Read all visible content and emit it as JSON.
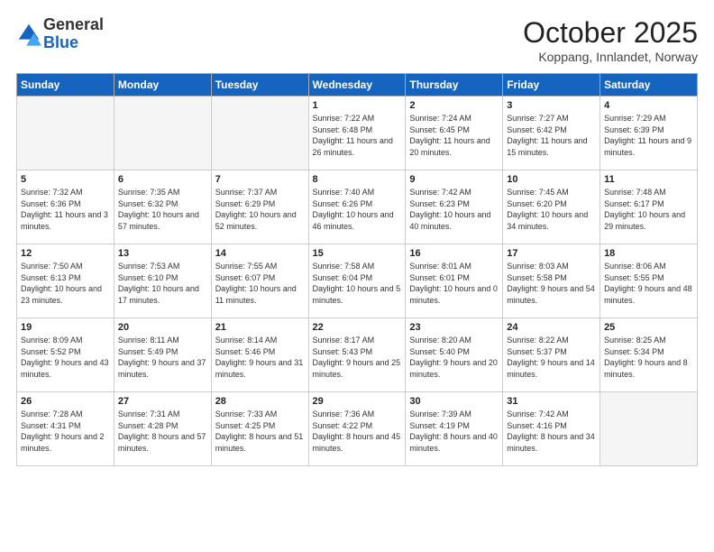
{
  "header": {
    "logo_general": "General",
    "logo_blue": "Blue",
    "month_title": "October 2025",
    "subtitle": "Koppang, Innlandet, Norway"
  },
  "days_of_week": [
    "Sunday",
    "Monday",
    "Tuesday",
    "Wednesday",
    "Thursday",
    "Friday",
    "Saturday"
  ],
  "weeks": [
    [
      {
        "day": "",
        "sunrise": "",
        "sunset": "",
        "daylight": "",
        "empty": true
      },
      {
        "day": "",
        "sunrise": "",
        "sunset": "",
        "daylight": "",
        "empty": true
      },
      {
        "day": "",
        "sunrise": "",
        "sunset": "",
        "daylight": "",
        "empty": true
      },
      {
        "day": "1",
        "sunrise": "Sunrise: 7:22 AM",
        "sunset": "Sunset: 6:48 PM",
        "daylight": "Daylight: 11 hours and 26 minutes.",
        "empty": false
      },
      {
        "day": "2",
        "sunrise": "Sunrise: 7:24 AM",
        "sunset": "Sunset: 6:45 PM",
        "daylight": "Daylight: 11 hours and 20 minutes.",
        "empty": false
      },
      {
        "day": "3",
        "sunrise": "Sunrise: 7:27 AM",
        "sunset": "Sunset: 6:42 PM",
        "daylight": "Daylight: 11 hours and 15 minutes.",
        "empty": false
      },
      {
        "day": "4",
        "sunrise": "Sunrise: 7:29 AM",
        "sunset": "Sunset: 6:39 PM",
        "daylight": "Daylight: 11 hours and 9 minutes.",
        "empty": false
      }
    ],
    [
      {
        "day": "5",
        "sunrise": "Sunrise: 7:32 AM",
        "sunset": "Sunset: 6:36 PM",
        "daylight": "Daylight: 11 hours and 3 minutes.",
        "empty": false
      },
      {
        "day": "6",
        "sunrise": "Sunrise: 7:35 AM",
        "sunset": "Sunset: 6:32 PM",
        "daylight": "Daylight: 10 hours and 57 minutes.",
        "empty": false
      },
      {
        "day": "7",
        "sunrise": "Sunrise: 7:37 AM",
        "sunset": "Sunset: 6:29 PM",
        "daylight": "Daylight: 10 hours and 52 minutes.",
        "empty": false
      },
      {
        "day": "8",
        "sunrise": "Sunrise: 7:40 AM",
        "sunset": "Sunset: 6:26 PM",
        "daylight": "Daylight: 10 hours and 46 minutes.",
        "empty": false
      },
      {
        "day": "9",
        "sunrise": "Sunrise: 7:42 AM",
        "sunset": "Sunset: 6:23 PM",
        "daylight": "Daylight: 10 hours and 40 minutes.",
        "empty": false
      },
      {
        "day": "10",
        "sunrise": "Sunrise: 7:45 AM",
        "sunset": "Sunset: 6:20 PM",
        "daylight": "Daylight: 10 hours and 34 minutes.",
        "empty": false
      },
      {
        "day": "11",
        "sunrise": "Sunrise: 7:48 AM",
        "sunset": "Sunset: 6:17 PM",
        "daylight": "Daylight: 10 hours and 29 minutes.",
        "empty": false
      }
    ],
    [
      {
        "day": "12",
        "sunrise": "Sunrise: 7:50 AM",
        "sunset": "Sunset: 6:13 PM",
        "daylight": "Daylight: 10 hours and 23 minutes.",
        "empty": false
      },
      {
        "day": "13",
        "sunrise": "Sunrise: 7:53 AM",
        "sunset": "Sunset: 6:10 PM",
        "daylight": "Daylight: 10 hours and 17 minutes.",
        "empty": false
      },
      {
        "day": "14",
        "sunrise": "Sunrise: 7:55 AM",
        "sunset": "Sunset: 6:07 PM",
        "daylight": "Daylight: 10 hours and 11 minutes.",
        "empty": false
      },
      {
        "day": "15",
        "sunrise": "Sunrise: 7:58 AM",
        "sunset": "Sunset: 6:04 PM",
        "daylight": "Daylight: 10 hours and 5 minutes.",
        "empty": false
      },
      {
        "day": "16",
        "sunrise": "Sunrise: 8:01 AM",
        "sunset": "Sunset: 6:01 PM",
        "daylight": "Daylight: 10 hours and 0 minutes.",
        "empty": false
      },
      {
        "day": "17",
        "sunrise": "Sunrise: 8:03 AM",
        "sunset": "Sunset: 5:58 PM",
        "daylight": "Daylight: 9 hours and 54 minutes.",
        "empty": false
      },
      {
        "day": "18",
        "sunrise": "Sunrise: 8:06 AM",
        "sunset": "Sunset: 5:55 PM",
        "daylight": "Daylight: 9 hours and 48 minutes.",
        "empty": false
      }
    ],
    [
      {
        "day": "19",
        "sunrise": "Sunrise: 8:09 AM",
        "sunset": "Sunset: 5:52 PM",
        "daylight": "Daylight: 9 hours and 43 minutes.",
        "empty": false
      },
      {
        "day": "20",
        "sunrise": "Sunrise: 8:11 AM",
        "sunset": "Sunset: 5:49 PM",
        "daylight": "Daylight: 9 hours and 37 minutes.",
        "empty": false
      },
      {
        "day": "21",
        "sunrise": "Sunrise: 8:14 AM",
        "sunset": "Sunset: 5:46 PM",
        "daylight": "Daylight: 9 hours and 31 minutes.",
        "empty": false
      },
      {
        "day": "22",
        "sunrise": "Sunrise: 8:17 AM",
        "sunset": "Sunset: 5:43 PM",
        "daylight": "Daylight: 9 hours and 25 minutes.",
        "empty": false
      },
      {
        "day": "23",
        "sunrise": "Sunrise: 8:20 AM",
        "sunset": "Sunset: 5:40 PM",
        "daylight": "Daylight: 9 hours and 20 minutes.",
        "empty": false
      },
      {
        "day": "24",
        "sunrise": "Sunrise: 8:22 AM",
        "sunset": "Sunset: 5:37 PM",
        "daylight": "Daylight: 9 hours and 14 minutes.",
        "empty": false
      },
      {
        "day": "25",
        "sunrise": "Sunrise: 8:25 AM",
        "sunset": "Sunset: 5:34 PM",
        "daylight": "Daylight: 9 hours and 8 minutes.",
        "empty": false
      }
    ],
    [
      {
        "day": "26",
        "sunrise": "Sunrise: 7:28 AM",
        "sunset": "Sunset: 4:31 PM",
        "daylight": "Daylight: 9 hours and 2 minutes.",
        "empty": false
      },
      {
        "day": "27",
        "sunrise": "Sunrise: 7:31 AM",
        "sunset": "Sunset: 4:28 PM",
        "daylight": "Daylight: 8 hours and 57 minutes.",
        "empty": false
      },
      {
        "day": "28",
        "sunrise": "Sunrise: 7:33 AM",
        "sunset": "Sunset: 4:25 PM",
        "daylight": "Daylight: 8 hours and 51 minutes.",
        "empty": false
      },
      {
        "day": "29",
        "sunrise": "Sunrise: 7:36 AM",
        "sunset": "Sunset: 4:22 PM",
        "daylight": "Daylight: 8 hours and 45 minutes.",
        "empty": false
      },
      {
        "day": "30",
        "sunrise": "Sunrise: 7:39 AM",
        "sunset": "Sunset: 4:19 PM",
        "daylight": "Daylight: 8 hours and 40 minutes.",
        "empty": false
      },
      {
        "day": "31",
        "sunrise": "Sunrise: 7:42 AM",
        "sunset": "Sunset: 4:16 PM",
        "daylight": "Daylight: 8 hours and 34 minutes.",
        "empty": false
      },
      {
        "day": "",
        "sunrise": "",
        "sunset": "",
        "daylight": "",
        "empty": true
      }
    ]
  ]
}
